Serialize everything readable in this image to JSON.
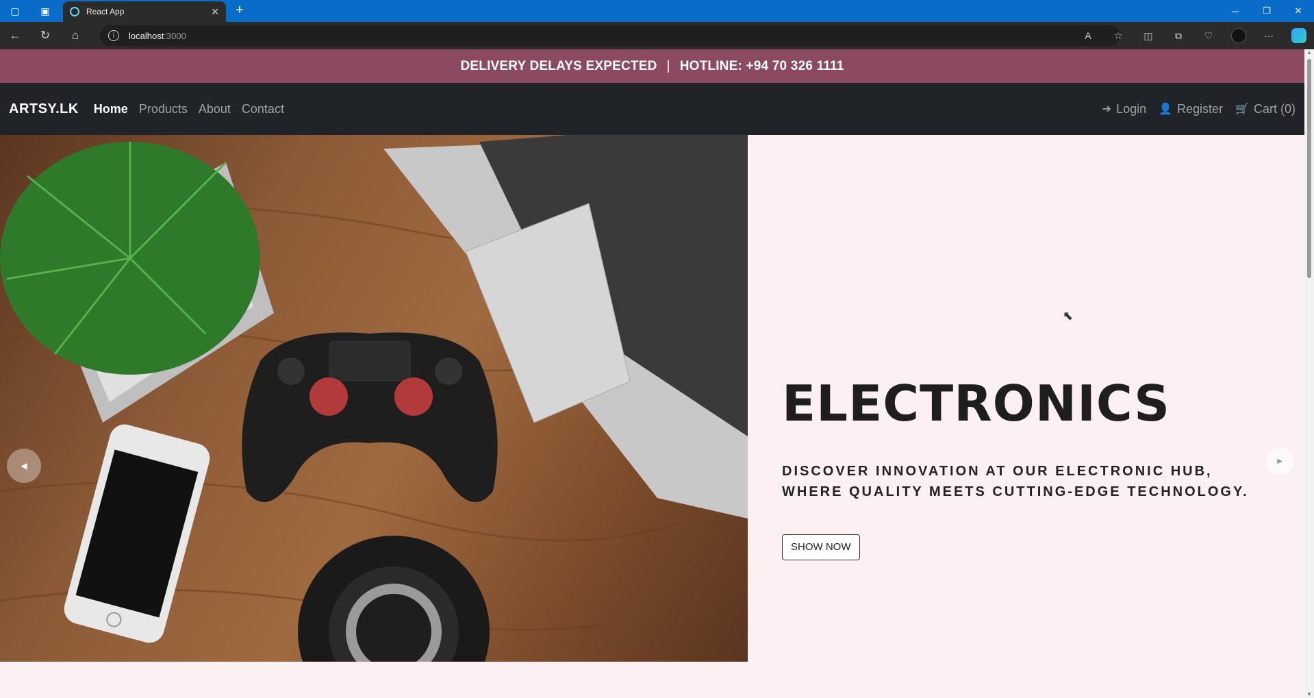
{
  "browser": {
    "tab_title": "React App",
    "url_host": "localhost",
    "url_port": ":3000",
    "new_tab": "+",
    "tab_close": "✕"
  },
  "announcement": {
    "left": "DELIVERY DELAYS EXPECTED",
    "separator": "|",
    "right": "HOTLINE: +94 70 326 1111"
  },
  "navbar": {
    "brand": "ARTSY.LK",
    "links": [
      "Home",
      "Products",
      "About",
      "Contact"
    ],
    "login": "Login",
    "register": "Register",
    "cart": "Cart (0)"
  },
  "hero": {
    "title": "ELECTRONICS",
    "description": "DISCOVER INNOVATION AT OUR ELECTRONIC HUB, WHERE QUALITY MEETS CUTTING-EDGE TECHNOLOGY.",
    "button": "SHOW NOW"
  }
}
